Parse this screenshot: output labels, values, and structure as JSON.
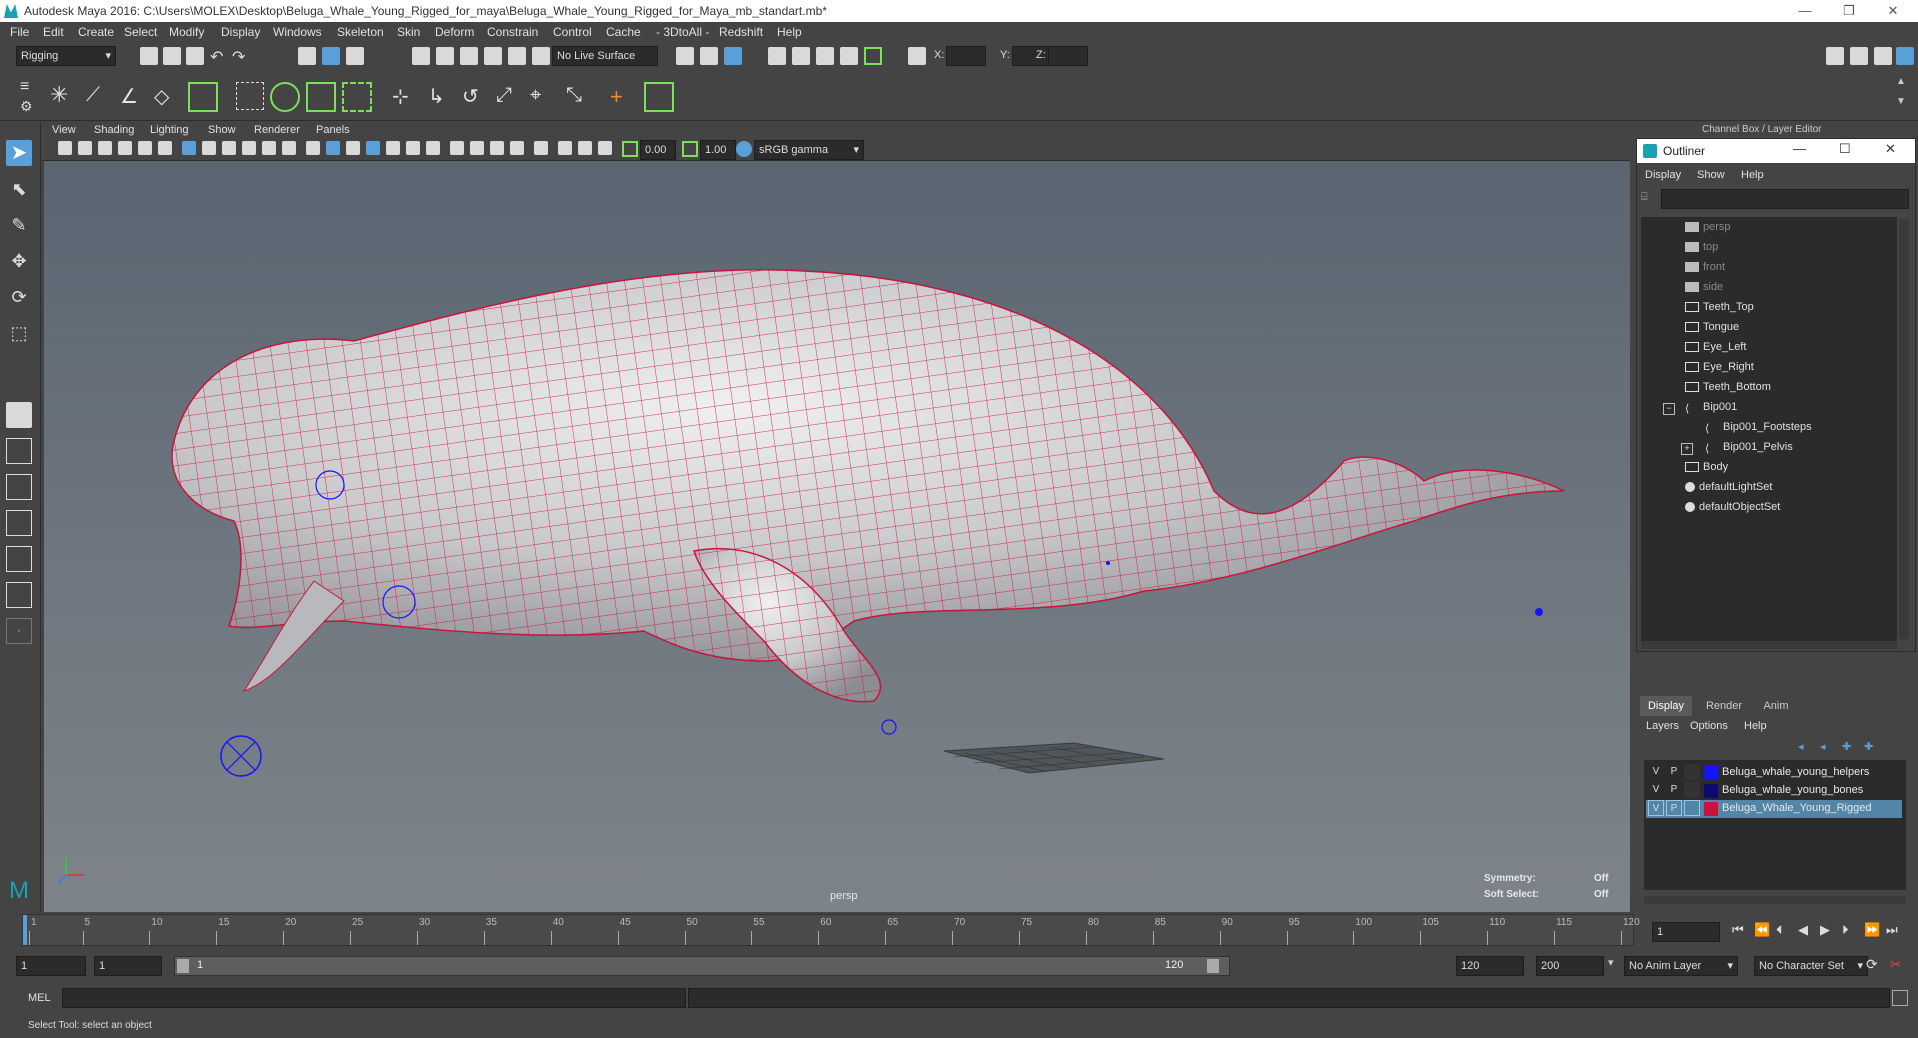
{
  "window": {
    "title": "Autodesk Maya 2016: C:\\Users\\MOLEX\\Desktop\\Beluga_Whale_Young_Rigged_for_maya\\Beluga_Whale_Young_Rigged_for_Maya_mb_standart.mb*"
  },
  "menu": [
    "File",
    "Edit",
    "Create",
    "Select",
    "Modify",
    "Display",
    "Windows",
    "Skeleton",
    "Skin",
    "Deform",
    "Constrain",
    "Control",
    "Cache",
    "- 3DtoAll -",
    "Redshift",
    "Help"
  ],
  "status": {
    "mode": "Rigging",
    "live_surface": "No Live Surface",
    "x_label": "X:",
    "y_label": "Y:",
    "z_label": "Z:"
  },
  "viewport": {
    "menu": [
      "View",
      "Shading",
      "Lighting",
      "Show",
      "Renderer",
      "Panels"
    ],
    "exposure": "0.00",
    "gamma": "1.00",
    "color_space": "sRGB gamma",
    "camera_label": "persp",
    "symmetry_label": "Symmetry:",
    "symmetry_value": "Off",
    "soft_select_label": "Soft Select:",
    "soft_select_value": "Off"
  },
  "channel_box_title": "Channel Box / Layer Editor",
  "outliner": {
    "title": "Outliner",
    "menu": [
      "Display",
      "Show",
      "Help"
    ],
    "items": [
      {
        "label": "persp",
        "type": "camera",
        "dim": true
      },
      {
        "label": "top",
        "type": "camera",
        "dim": true
      },
      {
        "label": "front",
        "type": "camera",
        "dim": true
      },
      {
        "label": "side",
        "type": "camera",
        "dim": true
      },
      {
        "label": "Teeth_Top",
        "type": "mesh",
        "dim": false
      },
      {
        "label": "Tongue",
        "type": "mesh",
        "dim": false
      },
      {
        "label": "Eye_Left",
        "type": "mesh",
        "dim": false
      },
      {
        "label": "Eye_Right",
        "type": "mesh",
        "dim": false
      },
      {
        "label": "Teeth_Bottom",
        "type": "mesh",
        "dim": false
      },
      {
        "label": "Bip001",
        "type": "joint",
        "dim": false
      },
      {
        "label": "Bip001_Footsteps",
        "type": "joint",
        "dim": false
      },
      {
        "label": "Bip001_Pelvis",
        "type": "joint",
        "dim": false
      },
      {
        "label": "Body",
        "type": "mesh",
        "dim": false
      },
      {
        "label": "defaultLightSet",
        "type": "set",
        "dim": false
      },
      {
        "label": "defaultObjectSet",
        "type": "set",
        "dim": false
      }
    ]
  },
  "layer_editor": {
    "tabs": [
      "Display",
      "Render",
      "Anim"
    ],
    "menu": [
      "Layers",
      "Options",
      "Help"
    ],
    "layers": [
      {
        "v": "V",
        "p": "P",
        "name": "Beluga_whale_young_helpers",
        "color": "#1414ff",
        "selected": false
      },
      {
        "v": "V",
        "p": "P",
        "name": "Beluga_whale_young_bones",
        "color": "#0b0b6e",
        "selected": false
      },
      {
        "v": "V",
        "p": "P",
        "name": "Beluga_Whale_Young_Rigged",
        "color": "#c8143c",
        "selected": true
      }
    ]
  },
  "timeline": {
    "ticks": [
      "1",
      "5",
      "10",
      "15",
      "20",
      "25",
      "30",
      "35",
      "40",
      "45",
      "50",
      "55",
      "60",
      "65",
      "70",
      "75",
      "80",
      "85",
      "90",
      "95",
      "100",
      "105",
      "110",
      "115",
      "120"
    ],
    "current_frame": "1"
  },
  "range": {
    "start": "1",
    "playback_start": "1",
    "range_start_label": "1",
    "range_end_label": "120",
    "playback_end": "120",
    "end": "200",
    "anim_layer": "No Anim Layer",
    "character_set": "No Character Set"
  },
  "command": {
    "label": "MEL"
  },
  "help_line": "Select Tool: select an object",
  "colors": {
    "accent": "#5aa0d8",
    "wire": "#c8143c"
  }
}
